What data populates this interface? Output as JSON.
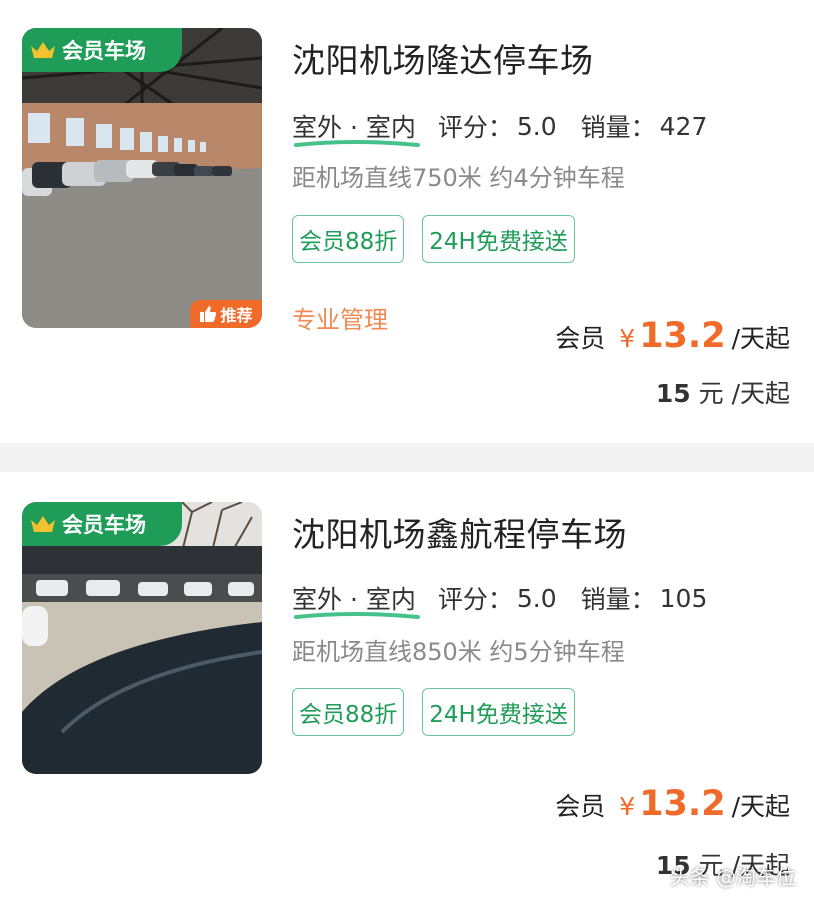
{
  "colors": {
    "brand_green": "#1f9c58",
    "accent_orange": "#f06b2a",
    "tag_border": "#69c49a"
  },
  "listings": [
    {
      "badge": "会员车场",
      "recommend": "推荐",
      "title": "沈阳机场隆达停车场",
      "location": "室外 · 室内",
      "rating_label": "评分：",
      "rating": "5.0",
      "sales_label": "销量：",
      "sales": "427",
      "distance": "距机场直线750米 约4分钟车程",
      "tags": [
        "会员88折",
        "24H免费接送"
      ],
      "extra": "专业管理",
      "member_label": "会员",
      "currency": "¥",
      "member_price": "13.2",
      "price_unit": "/天起",
      "orig_price": "15",
      "orig_unit": "元 /天起"
    },
    {
      "badge": "会员车场",
      "title": "沈阳机场鑫航程停车场",
      "location": "室外 · 室内",
      "rating_label": "评分：",
      "rating": "5.0",
      "sales_label": "销量：",
      "sales": "105",
      "distance": "距机场直线850米 约5分钟车程",
      "tags": [
        "会员88折",
        "24H免费接送"
      ],
      "member_label": "会员",
      "currency": "¥",
      "member_price": "13.2",
      "price_unit": "/天起",
      "orig_price": "15",
      "orig_unit": "元 /天起"
    }
  ],
  "watermark": "头条 @淘车位",
  "icons": [
    "crown-icon",
    "thumbs-up-icon"
  ]
}
